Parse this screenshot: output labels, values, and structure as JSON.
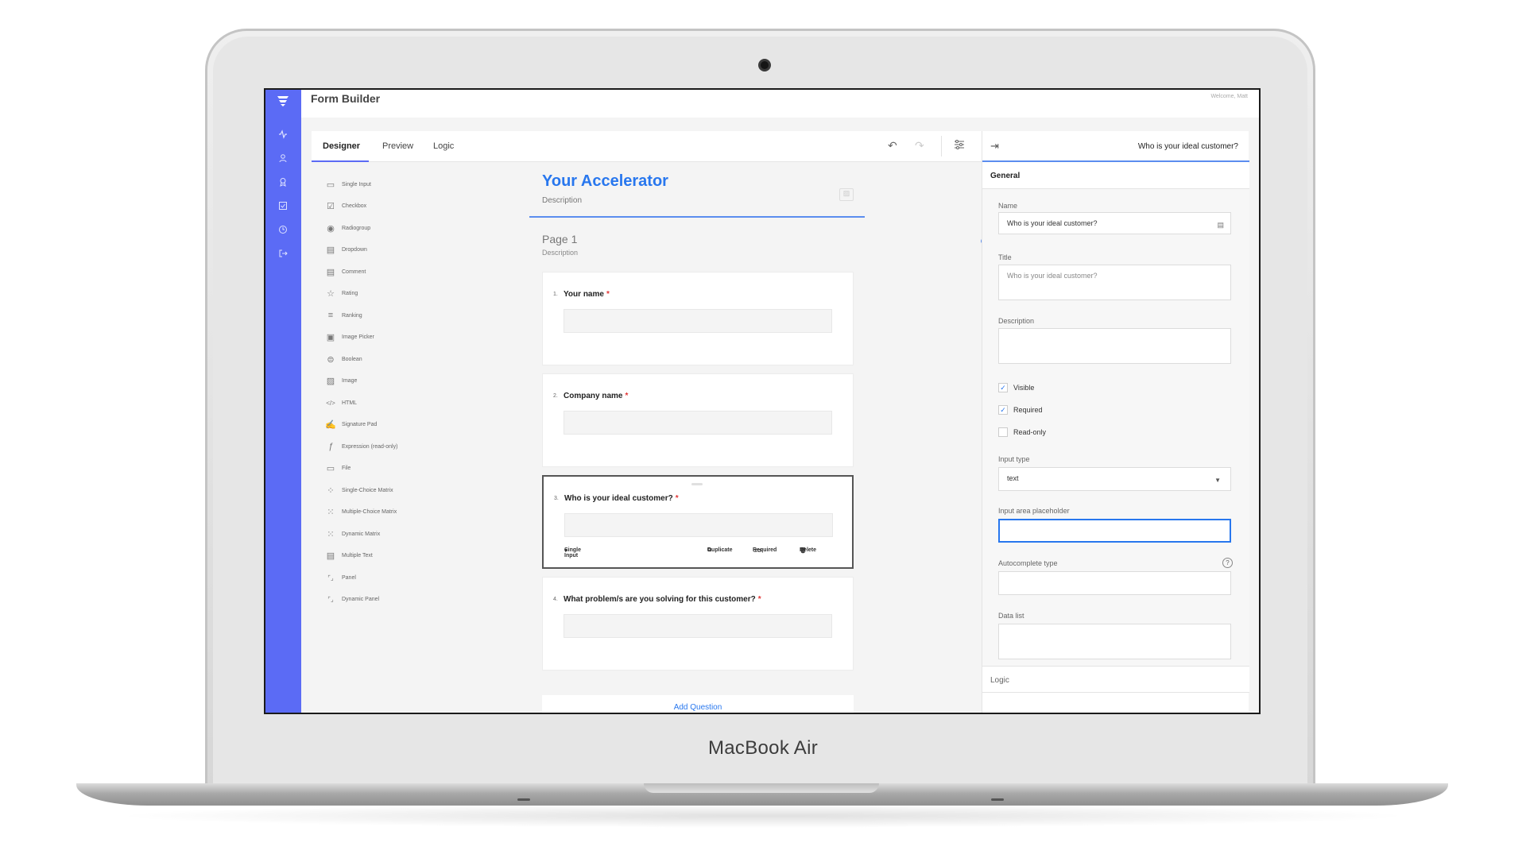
{
  "device": {
    "model_label": "MacBook Air"
  },
  "app": {
    "title": "Form Builder",
    "welcome": "Welcome, Matt",
    "accent": "#5b6bf5",
    "link_color": "#2877ee"
  },
  "sidebar": {
    "icons": [
      "activity-icon",
      "user-icon",
      "award-icon",
      "check-square-icon",
      "clock-icon",
      "logout-icon"
    ]
  },
  "tabs": {
    "designer": "Designer",
    "preview": "Preview",
    "logic": "Logic"
  },
  "toolbox": [
    {
      "label": "Single Input",
      "icon": "▭"
    },
    {
      "label": "Checkbox",
      "icon": "☑"
    },
    {
      "label": "Radiogroup",
      "icon": "◉"
    },
    {
      "label": "Dropdown",
      "icon": "▤"
    },
    {
      "label": "Comment",
      "icon": "▤"
    },
    {
      "label": "Rating",
      "icon": "☆"
    },
    {
      "label": "Ranking",
      "icon": "≡"
    },
    {
      "label": "Image Picker",
      "icon": "▣"
    },
    {
      "label": "Boolean",
      "icon": "⊜"
    },
    {
      "label": "Image",
      "icon": "▨"
    },
    {
      "label": "HTML",
      "icon": "</>"
    },
    {
      "label": "Signature Pad",
      "icon": "✍"
    },
    {
      "label": "Expression (read-only)",
      "icon": "ƒ"
    },
    {
      "label": "File",
      "icon": "▭"
    },
    {
      "label": "Single-Choice Matrix",
      "icon": "⁘"
    },
    {
      "label": "Multiple-Choice Matrix",
      "icon": "⁙"
    },
    {
      "label": "Dynamic Matrix",
      "icon": "⁙"
    },
    {
      "label": "Multiple Text",
      "icon": "▤"
    },
    {
      "label": "Panel",
      "icon": "⌜⌟"
    },
    {
      "label": "Dynamic Panel",
      "icon": "⌜⌟"
    }
  ],
  "survey": {
    "title": "Your Accelerator",
    "description": "Description"
  },
  "page": {
    "title": "Page 1",
    "description": "Description"
  },
  "questions": [
    {
      "num": "1.",
      "text": "Your name",
      "required_mark": "*"
    },
    {
      "num": "2.",
      "text": "Company name",
      "required_mark": "*"
    },
    {
      "num": "3.",
      "text": "Who is your ideal customer?",
      "required_mark": "*"
    },
    {
      "num": "4.",
      "text": "What problem/s are you solving for this customer?",
      "required_mark": "*"
    }
  ],
  "question_actions": {
    "type": "Single Input",
    "duplicate": "Duplicate",
    "required": "Required",
    "delete": "Delete"
  },
  "add_question": "Add Question",
  "properties": {
    "header_title": "Who is your ideal customer?",
    "section_general": "General",
    "name_label": "Name",
    "name_value": "Who is your ideal customer?",
    "title_label": "Title",
    "title_value": "Who is your ideal customer?",
    "description_label": "Description",
    "visible_label": "Visible",
    "visible_checked": true,
    "required_label": "Required",
    "required_checked": true,
    "readonly_label": "Read-only",
    "readonly_checked": false,
    "input_type_label": "Input type",
    "input_type_value": "text",
    "placeholder_label": "Input area placeholder",
    "autocomplete_label": "Autocomplete type",
    "datalist_label": "Data list",
    "section_logic": "Logic"
  }
}
